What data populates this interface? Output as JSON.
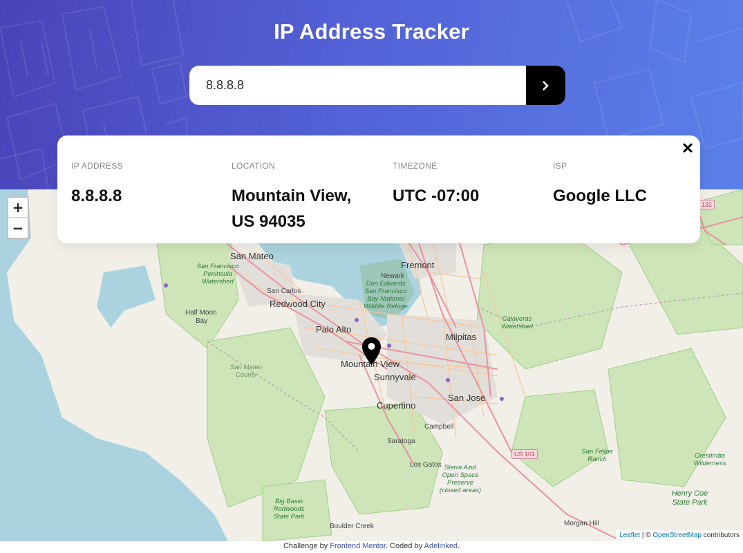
{
  "header": {
    "title": "IP Address Tracker"
  },
  "search": {
    "value": "8.8.8.8",
    "button_icon": "chevron-right-icon"
  },
  "info": {
    "ip": {
      "label": "IP ADDRESS",
      "value": "8.8.8.8"
    },
    "location": {
      "label": "LOCATION",
      "value": "Mountain View, US 94035"
    },
    "timezone": {
      "label": "TIMEZONE",
      "value": "UTC -07:00"
    },
    "isp": {
      "label": "ISP",
      "value": "Google LLC"
    },
    "close_icon": "close-icon"
  },
  "map": {
    "zoom_in": "+",
    "zoom_out": "−",
    "marker_icon": "location-pin-icon",
    "labels": {
      "san_mateo": "San Mateo",
      "fremont": "Fremont",
      "newark": "Newark",
      "san_carlos": "San Carlos",
      "redwood_city": "Redwood City",
      "half_moon_bay_1": "Half Moon",
      "half_moon_bay_2": "Bay",
      "palo_alto": "Palo Alto",
      "milpitas": "Milpitas",
      "mountain_view": "Mountain View",
      "sunnyvale": "Sunnyvale",
      "san_jose": "San Jose",
      "cupertino": "Cupertino",
      "campbell": "Campbell",
      "saratoga": "Saratoga",
      "los_gatos": "Los Gatos",
      "boulder_creek": "Boulder Creek",
      "morgan_hill": "Morgan Hill",
      "sf_watershed": "San Francisco Peninsula Watershed",
      "don_edwards": "Don Edwards San Francisco Bay National Wildlife Refuge",
      "calaveras": "Calaveras Watershed",
      "san_mateo_county": "San Mateo County",
      "sierra_azul": "Sierra Azul Open Space Preserve (closed areas)",
      "big_basin": "Big Basin Redwoods State Park",
      "san_felipe": "San Felipe Ranch",
      "orestimba": "Orestimba Wilderness",
      "henry_coe": "Henry Coe State Park",
      "us101": "US 101",
      "route132": "132"
    },
    "attribution": {
      "leaflet": "Leaflet",
      "separator": "| ©",
      "osm": "OpenStreetMap",
      "suffix": "contributors"
    }
  },
  "footer": {
    "prefix": "Challenge by",
    "frontend_mentor": "Frontend Mentor",
    "middle": ". Coded by",
    "author": "Adelinked",
    "suffix": "."
  },
  "colors": {
    "header_gradient_start": "#4a43b8",
    "header_gradient_end": "#5b80ea",
    "water": "#aad3df",
    "land": "#f2efe9",
    "forest": "#cde5b8",
    "road_major": "#e892a2",
    "road_minor": "#f7c79a"
  }
}
